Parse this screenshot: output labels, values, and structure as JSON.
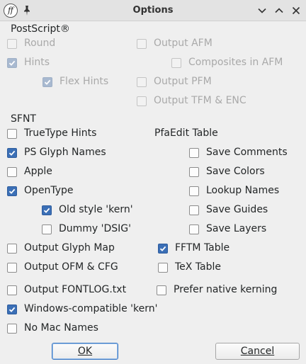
{
  "window": {
    "title": "Options",
    "app_icon_text": "ff"
  },
  "sections": {
    "postscript": "PostScript®",
    "sfnt": "SFNT",
    "pfaedit": "PfaEdit Table"
  },
  "options": {
    "round": {
      "label": "Round",
      "checked": false,
      "disabled": true
    },
    "hints": {
      "label": "Hints",
      "checked": true,
      "disabled": true
    },
    "flex_hints": {
      "label": "Flex Hints",
      "checked": true,
      "disabled": true
    },
    "output_afm": {
      "label": "Output AFM",
      "checked": false,
      "disabled": true
    },
    "composites_in_afm": {
      "label": "Composites in AFM",
      "checked": false,
      "disabled": true
    },
    "output_pfm": {
      "label": "Output PFM",
      "checked": false,
      "disabled": true
    },
    "output_tfm_enc": {
      "label": "Output TFM & ENC",
      "checked": false,
      "disabled": true
    },
    "truetype_hints": {
      "label": "TrueType Hints",
      "checked": false,
      "disabled": false
    },
    "ps_glyph_names": {
      "label": "PS Glyph Names",
      "checked": true,
      "disabled": false
    },
    "apple": {
      "label": "Apple",
      "checked": false,
      "disabled": false
    },
    "opentype": {
      "label": "OpenType",
      "checked": true,
      "disabled": false
    },
    "old_style_kern": {
      "label": "Old style 'kern'",
      "checked": true,
      "disabled": false
    },
    "dummy_dsig": {
      "label": "Dummy 'DSIG'",
      "checked": false,
      "disabled": false
    },
    "save_comments": {
      "label": "Save Comments",
      "checked": false,
      "disabled": false
    },
    "save_colors": {
      "label": "Save Colors",
      "checked": false,
      "disabled": false
    },
    "lookup_names": {
      "label": "Lookup Names",
      "checked": false,
      "disabled": false
    },
    "save_guides": {
      "label": "Save Guides",
      "checked": false,
      "disabled": false
    },
    "save_layers": {
      "label": "Save Layers",
      "checked": false,
      "disabled": false
    },
    "output_glyph_map": {
      "label": "Output Glyph Map",
      "checked": false,
      "disabled": false
    },
    "fftm_table": {
      "label": "FFTM Table",
      "checked": true,
      "disabled": false
    },
    "output_ofm_cfg": {
      "label": "Output OFM & CFG",
      "checked": false,
      "disabled": false
    },
    "tex_table": {
      "label": "TeX Table",
      "checked": false,
      "disabled": false
    },
    "output_fontlog": {
      "label": "Output FONTLOG.txt",
      "checked": false,
      "disabled": false
    },
    "prefer_native_kerning": {
      "label": "Prefer native kerning",
      "checked": false,
      "disabled": false
    },
    "windows_compatible_kern": {
      "label": "Windows-compatible 'kern'",
      "checked": true,
      "disabled": false
    },
    "no_mac_names": {
      "label": "No Mac Names",
      "checked": false,
      "disabled": false
    }
  },
  "buttons": {
    "ok": "OK",
    "cancel": "Cancel"
  },
  "colors": {
    "accent": "#3b6fb6",
    "background": "#efefef"
  }
}
